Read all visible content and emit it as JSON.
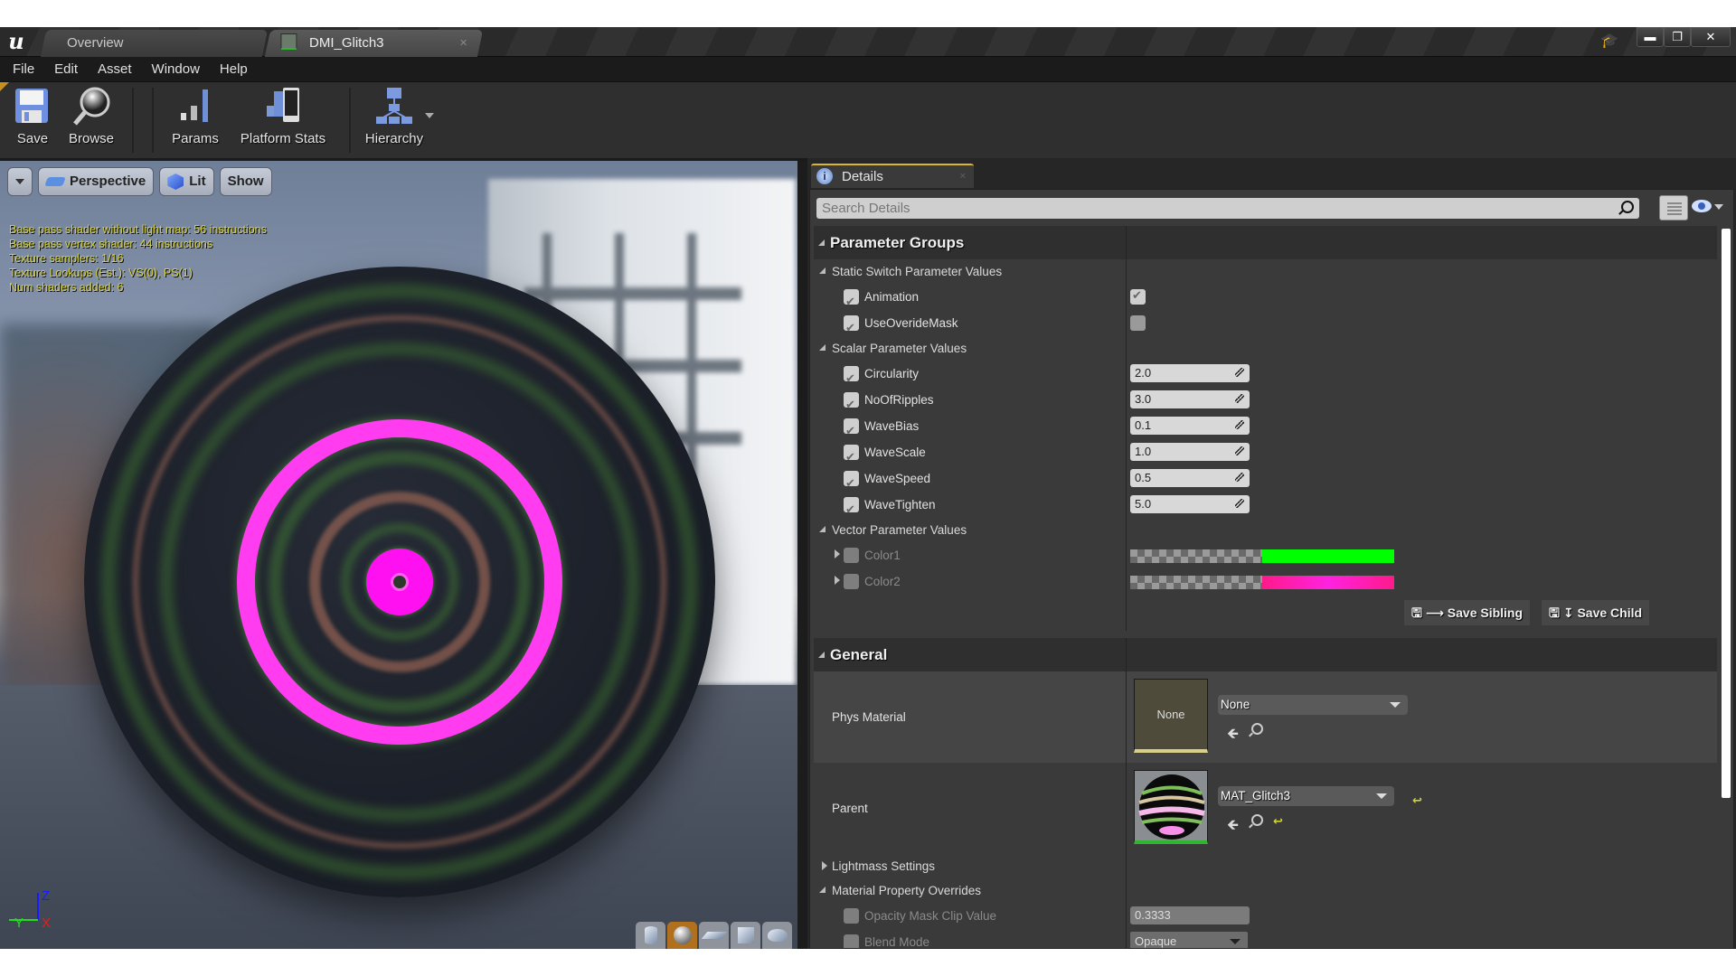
{
  "window": {
    "tabs": [
      {
        "label": "Overview",
        "active": false
      },
      {
        "label": "DMI_Glitch3",
        "active": true
      }
    ],
    "controls": {
      "minimize": "▬",
      "restore": "❐",
      "close": "✕"
    }
  },
  "menu": [
    "File",
    "Edit",
    "Asset",
    "Window",
    "Help"
  ],
  "toolbar": {
    "save": "Save",
    "browse": "Browse",
    "params": "Params",
    "platform_stats": "Platform Stats",
    "hierarchy": "Hierarchy"
  },
  "viewport": {
    "buttons": {
      "perspective": "Perspective",
      "lit": "Lit",
      "show": "Show"
    },
    "stats": [
      "Base pass shader without light map: 56 instructions",
      "Base pass vertex shader: 44 instructions",
      "Texture samplers: 1/16",
      "Texture Lookups (Est.): VS(0), PS(1)",
      "Num shaders added: 6"
    ],
    "axis": {
      "z": "Z",
      "y": "Y",
      "x": "X"
    },
    "preview_shapes": [
      "cylinder",
      "sphere",
      "plane",
      "cube",
      "teapot"
    ],
    "active_preview_shape": "sphere"
  },
  "details": {
    "tab_label": "Details",
    "search_placeholder": "Search Details",
    "parameter_groups": {
      "title": "Parameter Groups",
      "static_switch": {
        "title": "Static Switch Parameter Values",
        "items": [
          {
            "name": "Animation",
            "override": true,
            "value": true
          },
          {
            "name": "UseOverideMask",
            "override": true,
            "value": false
          }
        ]
      },
      "scalar": {
        "title": "Scalar Parameter Values",
        "items": [
          {
            "name": "Circularity",
            "value": "2.0"
          },
          {
            "name": "NoOfRipples",
            "value": "3.0"
          },
          {
            "name": "WaveBias",
            "value": "0.1"
          },
          {
            "name": "WaveScale",
            "value": "1.0"
          },
          {
            "name": "WaveSpeed",
            "value": "0.5"
          },
          {
            "name": "WaveTighten",
            "value": "5.0"
          }
        ]
      },
      "vector": {
        "title": "Vector Parameter Values",
        "items": [
          {
            "name": "Color1",
            "color": "#00ff00"
          },
          {
            "name": "Color2",
            "color": "#ff22e0"
          }
        ]
      },
      "save_sibling": "Save Sibling",
      "save_child": "Save Child"
    },
    "general": {
      "title": "General",
      "phys_material": {
        "label": "Phys Material",
        "thumb_text": "None",
        "value": "None"
      },
      "parent": {
        "label": "Parent",
        "value": "MAT_Glitch3"
      },
      "lightmass": "Lightmass Settings",
      "overrides": {
        "title": "Material Property Overrides",
        "opacity_mask": {
          "label": "Opacity Mask Clip Value",
          "value": "0.3333"
        },
        "blend_mode": {
          "label": "Blend Mode",
          "value": "Opaque"
        }
      }
    }
  },
  "colors": {
    "accent_tab": "#d9b530",
    "stats_text": "#d8d23a",
    "preview_active": "#b0701e"
  }
}
